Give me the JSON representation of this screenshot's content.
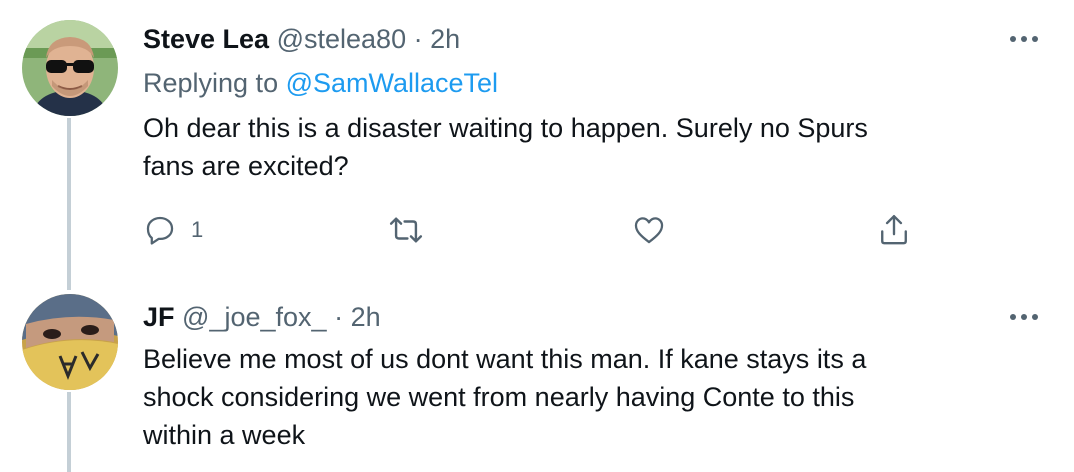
{
  "tweets": [
    {
      "author_name": "Steve Lea",
      "handle": "@stelea80",
      "separator": "·",
      "time": "2h",
      "replying_prefix": "Replying to ",
      "replying_to": "@SamWallaceTel",
      "lines": [
        "Oh dear this is a disaster waiting to happen.  Surely no Spurs",
        "fans are excited?"
      ],
      "actions": {
        "reply_count": "1",
        "reply_icon": "reply-icon",
        "retweet_icon": "retweet-icon",
        "like_icon": "heart-icon",
        "share_icon": "share-icon"
      }
    },
    {
      "author_name": "JF",
      "handle": "@_joe_fox_",
      "separator": "·",
      "time": "2h",
      "lines": [
        "Believe me most of us dont want this man. If kane stays its a",
        "shock considering we went from nearly having Conte to this",
        "within a week"
      ]
    }
  ],
  "colors": {
    "text": "#0f1419",
    "secondary": "#536471",
    "link": "#1d9bf0",
    "thread_line": "#c4cfd6"
  }
}
